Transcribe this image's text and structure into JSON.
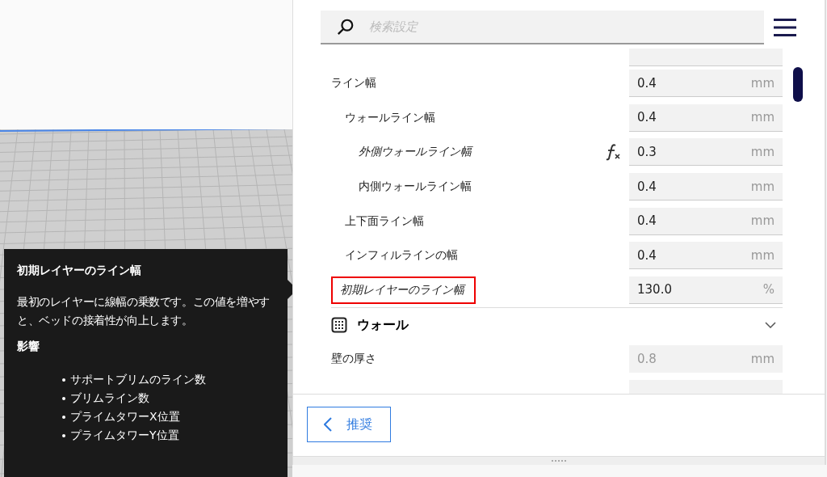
{
  "tooltip": {
    "title": "初期レイヤーのライン幅",
    "description": "最初のレイヤーに線幅の乗数です。この値を増やすと、ベッドの接着性が向上します。",
    "affects_heading": "影響",
    "affects": [
      "サポートブリムのライン数",
      "ブリムライン数",
      "プライムタワーX位置",
      "プライムタワーY位置"
    ]
  },
  "search": {
    "placeholder": "検索設定"
  },
  "settings": [
    {
      "label": "ライン幅",
      "value": "0.4",
      "unit": "mm",
      "modified": false,
      "formula": false,
      "highlighted": false,
      "disabled": false,
      "children": [
        {
          "label": "ウォールライン幅",
          "value": "0.4",
          "unit": "mm",
          "modified": false,
          "formula": false,
          "highlighted": false,
          "disabled": false,
          "children": [
            {
              "label": "外側ウォールライン幅",
              "value": "0.3",
              "unit": "mm",
              "modified": true,
              "formula": true,
              "highlighted": false,
              "disabled": false
            },
            {
              "label": "内側ウォールライン幅",
              "value": "0.4",
              "unit": "mm",
              "modified": false,
              "formula": false,
              "highlighted": false,
              "disabled": false
            }
          ]
        },
        {
          "label": "上下面ライン幅",
          "value": "0.4",
          "unit": "mm",
          "modified": false,
          "formula": false,
          "highlighted": false,
          "disabled": false
        },
        {
          "label": "インフィルラインの幅",
          "value": "0.4",
          "unit": "mm",
          "modified": false,
          "formula": false,
          "highlighted": false,
          "disabled": false
        }
      ]
    },
    {
      "label": "初期レイヤーのライン幅",
      "value": "130.0",
      "unit": "%",
      "modified": true,
      "formula": false,
      "highlighted": true,
      "disabled": false
    }
  ],
  "section": {
    "title": "ウォール",
    "expanded": true,
    "settings": [
      {
        "label": "壁の厚さ",
        "value": "0.8",
        "unit": "mm",
        "modified": false,
        "formula": false,
        "highlighted": false,
        "disabled": true
      }
    ]
  },
  "back_button": {
    "label": "推奨"
  }
}
